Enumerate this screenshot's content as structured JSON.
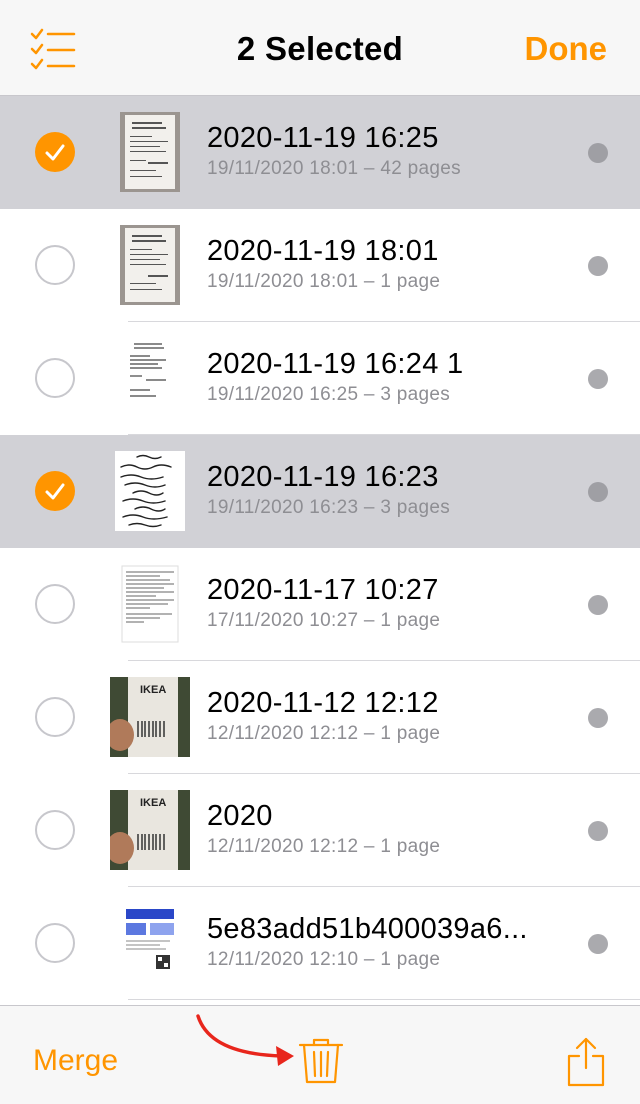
{
  "header": {
    "title": "2 Selected",
    "done_label": "Done",
    "select_icon": "checklist-icon"
  },
  "colors": {
    "accent": "#ff9500",
    "selected_row": "#d1d1d6",
    "secondary_text": "#8e8e93",
    "annotation_arrow": "#e8261c"
  },
  "rows": [
    {
      "name": "2020-11-19 16:25",
      "meta": "19/11/2020 18:01 – 42 pages",
      "selected": true
    },
    {
      "name": "2020-11-19 18:01",
      "meta": "19/11/2020 18:01 – 1 page",
      "selected": false
    },
    {
      "name": "2020-11-19 16:24 1",
      "meta": "19/11/2020 16:25 – 3 pages",
      "selected": false
    },
    {
      "name": "2020-11-19 16:23",
      "meta": "19/11/2020 16:23 – 3 pages",
      "selected": true
    },
    {
      "name": "2020-11-17 10:27",
      "meta": "17/11/2020 10:27 – 1 page",
      "selected": false
    },
    {
      "name": "2020-11-12 12:12",
      "meta": "12/11/2020 12:12 – 1 page",
      "selected": false
    },
    {
      "name": "2020",
      "meta": "12/11/2020 12:12 – 1 page",
      "selected": false
    },
    {
      "name": "5e83add51b400039a6...",
      "meta": "12/11/2020 12:10 – 1 page",
      "selected": false
    }
  ],
  "toolbar": {
    "merge_label": "Merge",
    "delete_icon": "trash-icon",
    "share_icon": "share-icon"
  }
}
